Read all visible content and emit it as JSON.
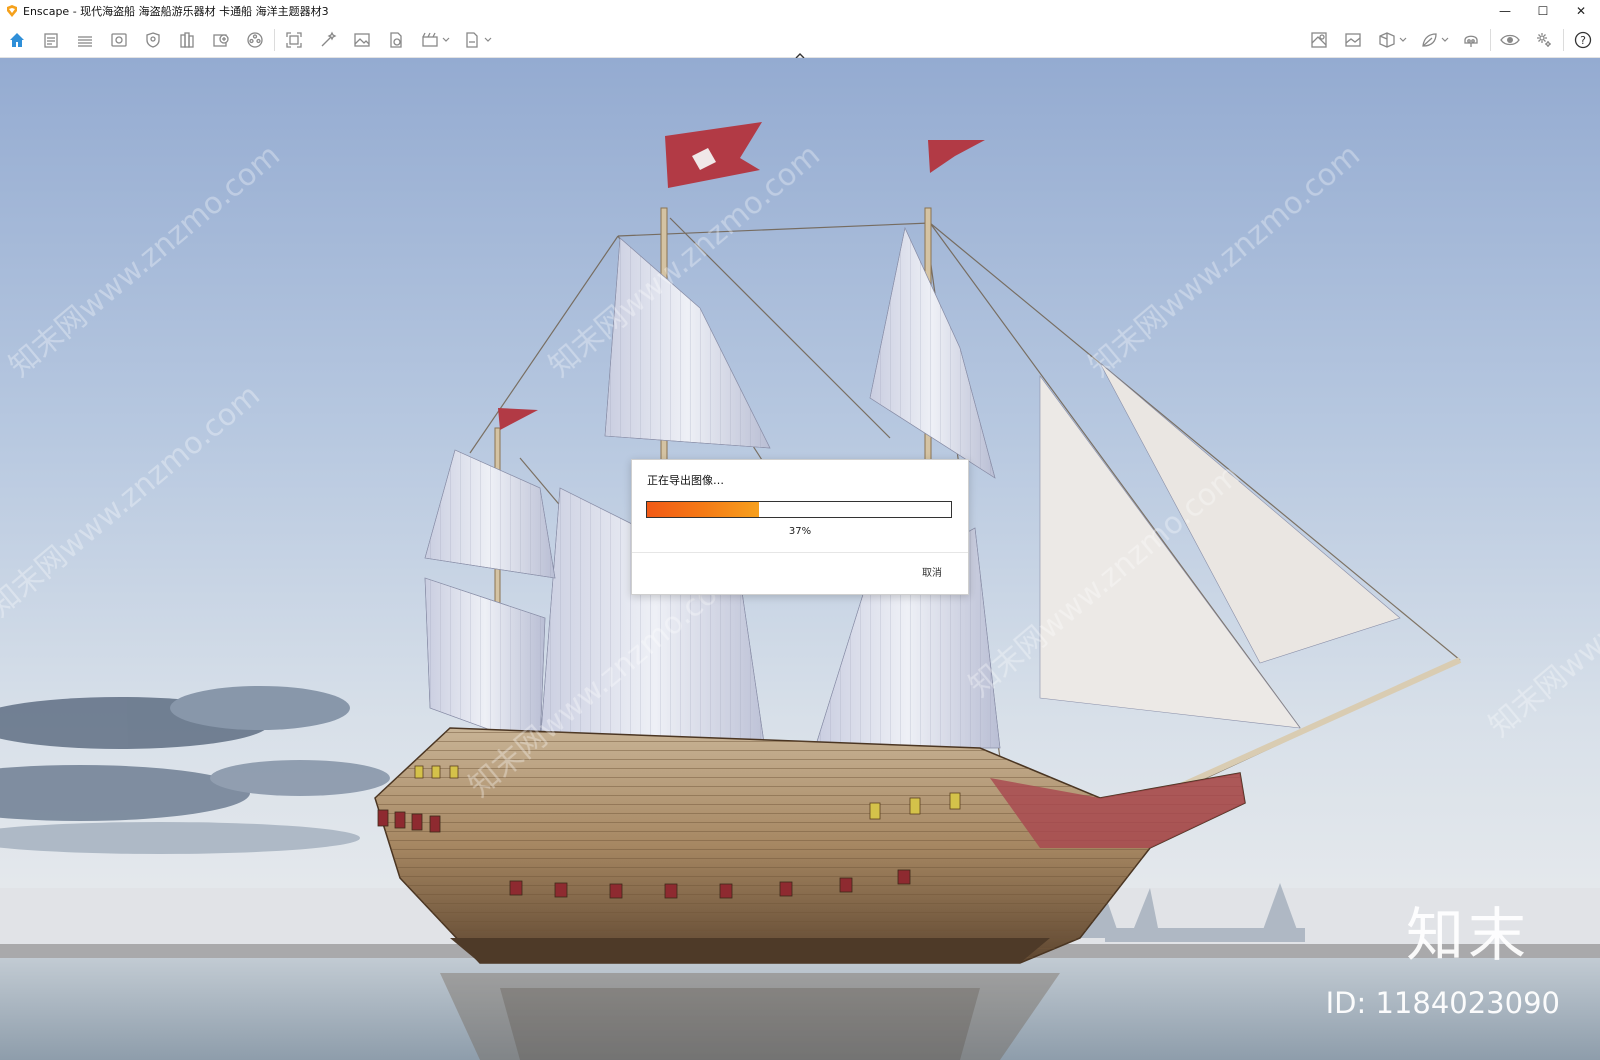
{
  "window": {
    "title": "Enscape - 现代海盗船 海盗船游乐器材 卡通船 海洋主题器材3",
    "controls": {
      "minimize": "—",
      "maximize": "☐",
      "close": "✕"
    }
  },
  "toolbar": {
    "left_icons": [
      "home-icon",
      "document-icon",
      "bim-icon",
      "views-icon",
      "shield-icon",
      "books-icon",
      "add-asset-icon",
      "materials-icon",
      "screenshot-icon",
      "magic-icon",
      "image-icon",
      "panorama-icon",
      "video-icon",
      "export-icon"
    ],
    "right_icons": [
      "map-icon",
      "picture-icon",
      "cube-icon",
      "leaf-icon",
      "vr-icon",
      "eye-icon",
      "settings-icon",
      "help-icon"
    ]
  },
  "dialog": {
    "title": "正在导出图像…",
    "progress": 0.37,
    "progress_label": "37%",
    "cancel_label": "取消"
  },
  "watermark": {
    "brand": "知末",
    "id": "ID: 1184023090",
    "diagonal": "知末网www.znzmo.com"
  },
  "colors": {
    "accent": "#f47a16",
    "sky_top": "#9fb4d6",
    "sea": "#b8c4ce"
  }
}
